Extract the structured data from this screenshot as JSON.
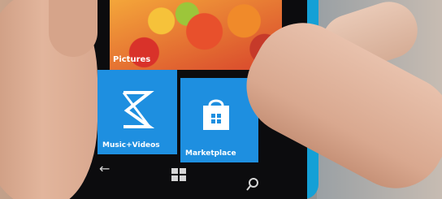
{
  "phone_screen": {
    "tiles": {
      "pictures": {
        "label": "Pictures"
      },
      "music_videos": {
        "label": "Music+Videos"
      },
      "marketplace": {
        "label": "Marketplace"
      }
    },
    "accent_color": "#1e8fe0",
    "nav_icons": [
      "back-arrow-icon",
      "windows-start-icon",
      "search-icon"
    ]
  }
}
